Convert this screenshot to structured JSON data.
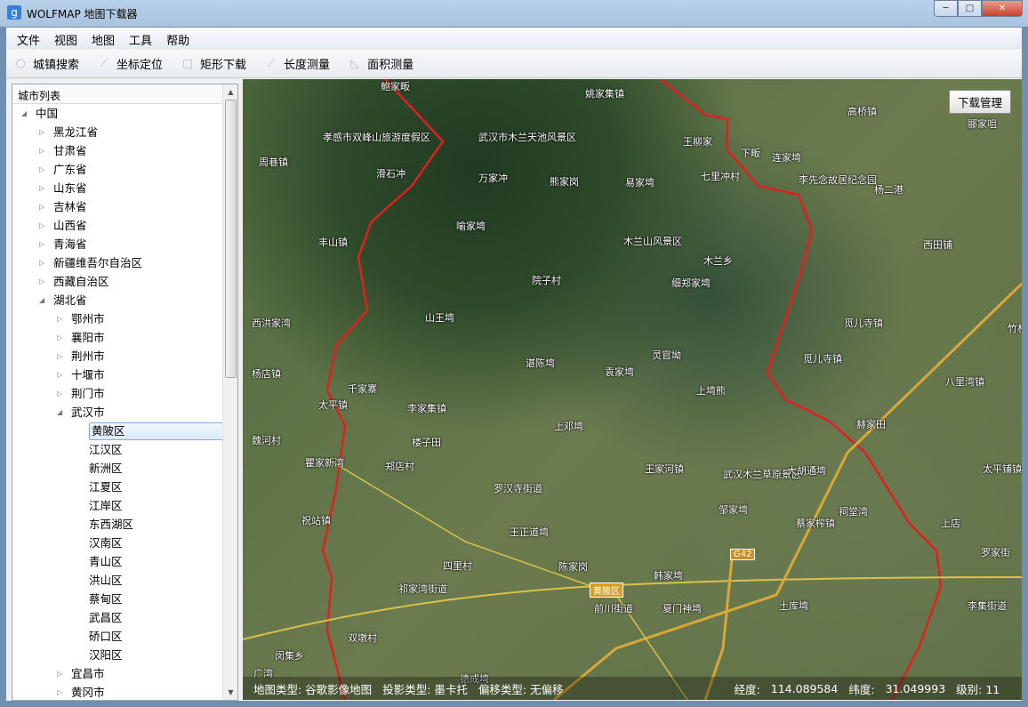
{
  "window": {
    "title": "WOLFMAP 地图下载器",
    "icon": "g",
    "min": "─",
    "max": "□",
    "close": "✕"
  },
  "menu": [
    "文件",
    "视图",
    "地图",
    "工具",
    "帮助"
  ],
  "toolbar": [
    {
      "label": "城镇搜索",
      "icon": "search-icon"
    },
    {
      "label": "坐标定位",
      "icon": "ruler-icon"
    },
    {
      "label": "矩形下载",
      "icon": "rectangle-icon"
    },
    {
      "label": "长度测量",
      "icon": "ruler-icon"
    },
    {
      "label": "面积测量",
      "icon": "area-icon"
    }
  ],
  "sidebar": {
    "header": "城市列表",
    "tree": [
      {
        "label": "中国",
        "level": 0,
        "state": "open"
      },
      {
        "label": "黑龙江省",
        "level": 1,
        "state": "closed"
      },
      {
        "label": "甘肃省",
        "level": 1,
        "state": "closed"
      },
      {
        "label": "广东省",
        "level": 1,
        "state": "closed"
      },
      {
        "label": "山东省",
        "level": 1,
        "state": "closed"
      },
      {
        "label": "吉林省",
        "level": 1,
        "state": "closed"
      },
      {
        "label": "山西省",
        "level": 1,
        "state": "closed"
      },
      {
        "label": "青海省",
        "level": 1,
        "state": "closed"
      },
      {
        "label": "新疆维吾尔自治区",
        "level": 1,
        "state": "closed"
      },
      {
        "label": "西藏自治区",
        "level": 1,
        "state": "closed"
      },
      {
        "label": "湖北省",
        "level": 1,
        "state": "open"
      },
      {
        "label": "鄂州市",
        "level": 2,
        "state": "closed"
      },
      {
        "label": "襄阳市",
        "level": 2,
        "state": "closed"
      },
      {
        "label": "荆州市",
        "level": 2,
        "state": "closed"
      },
      {
        "label": "十堰市",
        "level": 2,
        "state": "closed"
      },
      {
        "label": "荆门市",
        "level": 2,
        "state": "closed"
      },
      {
        "label": "武汉市",
        "level": 2,
        "state": "open"
      },
      {
        "label": "黄陂区",
        "level": 3,
        "state": "leaf",
        "selected": true
      },
      {
        "label": "江汉区",
        "level": 3,
        "state": "leaf"
      },
      {
        "label": "新洲区",
        "level": 3,
        "state": "leaf"
      },
      {
        "label": "江夏区",
        "level": 3,
        "state": "leaf"
      },
      {
        "label": "江岸区",
        "level": 3,
        "state": "leaf"
      },
      {
        "label": "东西湖区",
        "level": 3,
        "state": "leaf"
      },
      {
        "label": "汉南区",
        "level": 3,
        "state": "leaf"
      },
      {
        "label": "青山区",
        "level": 3,
        "state": "leaf"
      },
      {
        "label": "洪山区",
        "level": 3,
        "state": "leaf"
      },
      {
        "label": "蔡甸区",
        "level": 3,
        "state": "leaf"
      },
      {
        "label": "武昌区",
        "level": 3,
        "state": "leaf"
      },
      {
        "label": "硚口区",
        "level": 3,
        "state": "leaf"
      },
      {
        "label": "汉阳区",
        "level": 3,
        "state": "leaf"
      },
      {
        "label": "宜昌市",
        "level": 2,
        "state": "closed"
      },
      {
        "label": "黄冈市",
        "level": 2,
        "state": "closed"
      }
    ]
  },
  "map": {
    "download_manager": "下载管理",
    "labels": [
      "鲍家畈",
      "姚家集镇",
      "高桥镇",
      "郦家咀",
      "孝感市双峰山旅游度假区",
      "武汉市木兰天池风景区",
      "王柳家",
      "下畈",
      "连家塆",
      "周巷镇",
      "滑石冲",
      "万家冲",
      "熊家岗",
      "易家塆",
      "七里冲村",
      "李先念故居纪念园",
      "杨二港",
      "喻家塆",
      "丰山镇",
      "木兰山风景区",
      "木兰乡",
      "西田铺",
      "院子村",
      "细郑家塆",
      "西洪家湾",
      "山王塆",
      "觅儿寺镇",
      "竹林",
      "灵官坳",
      "觅儿寺镇",
      "杨店镇",
      "谌陈塆",
      "袁家塆",
      "上塆熊",
      "八里湾镇",
      "千家寨",
      "太平镇",
      "李家集镇",
      "赫家田",
      "上邓塆",
      "魏河村",
      "楼子田",
      "王家河镇",
      "武汉木兰草原景区",
      "大胡通塆",
      "太平铺镇",
      "瞿家新湾",
      "郑店村",
      "罗汉寺街道",
      "邹家塆",
      "祠堂湾",
      "蔡家榨镇",
      "祝站镇",
      "上店",
      "王正道塆",
      "罗家街",
      "四里村",
      "陈家岗",
      "韩家塆",
      "祁家湾街道",
      "前川街道",
      "夏门神塆",
      "土库塆",
      "李集街道",
      "双墩村",
      "闵集乡",
      "广湾",
      "德成塆"
    ],
    "road_badges": [
      "黄陂区",
      "G42"
    ]
  },
  "status": {
    "map_type": "地图类型: 谷歌影像地图",
    "projection": "投影类型: 墨卡托",
    "offset": "偏移类型: 无偏移",
    "lng_label": "经度:",
    "lng": "114.089584",
    "lat_label": "纬度:",
    "lat": "31.049993",
    "level": "级别: 11"
  }
}
